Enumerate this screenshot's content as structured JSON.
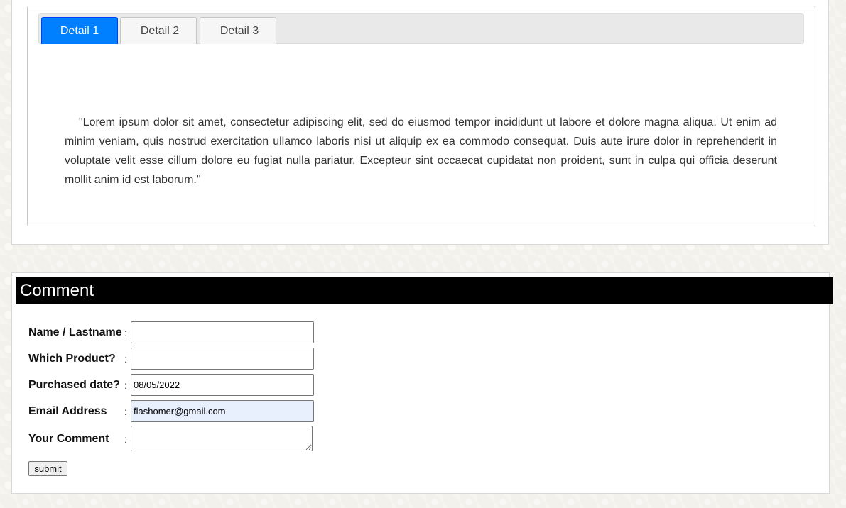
{
  "details": {
    "tabs": [
      {
        "label": "Detail 1",
        "active": true
      },
      {
        "label": "Detail 2",
        "active": false
      },
      {
        "label": "Detail 3",
        "active": false
      }
    ],
    "content": "\"Lorem ipsum dolor sit amet, consectetur adipiscing elit, sed do eiusmod tempor incididunt ut labore et dolore magna aliqua. Ut enim ad minim veniam, quis nostrud exercitation ullamco laboris nisi ut aliquip ex ea commodo consequat. Duis aute irure dolor in reprehenderit in voluptate velit esse cillum dolore eu fugiat nulla pariatur. Excepteur sint occaecat cupidatat non proident, sunt in culpa qui officia deserunt mollit anim id est laborum.\""
  },
  "comment": {
    "title": "Comment",
    "fields": {
      "name": {
        "label": "Name / Lastname",
        "value": ""
      },
      "product": {
        "label": "Which Product?",
        "value": ""
      },
      "date": {
        "label": "Purchased date?",
        "value": "08/05/2022"
      },
      "email": {
        "label": "Email Address",
        "value": "flashomer@gmail.com"
      },
      "comment": {
        "label": "Your Comment",
        "value": ""
      }
    },
    "separator": ":",
    "submit_label": "submit"
  },
  "colors": {
    "active_tab": "#007fff",
    "header_bg": "#000000",
    "autofill_bg": "#e8f0fe"
  }
}
